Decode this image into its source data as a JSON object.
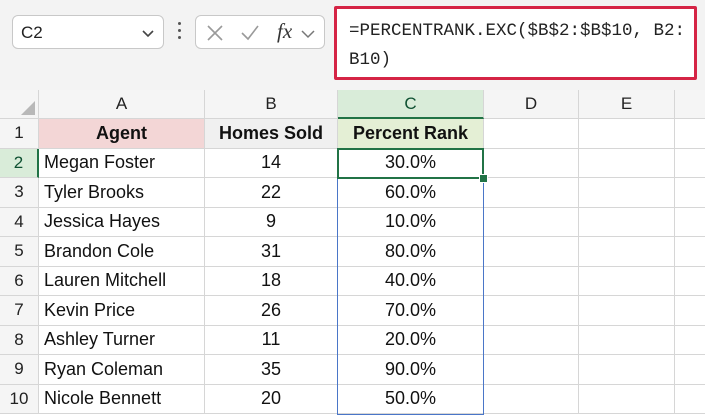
{
  "name_box": {
    "value": "C2"
  },
  "formula_bar": {
    "fx_label": "fx",
    "formula": "=PERCENTRANK.EXC($B$2:$B$10, B2:B10)"
  },
  "columns": [
    "A",
    "B",
    "C",
    "D",
    "E"
  ],
  "rows": [
    "1",
    "2",
    "3",
    "4",
    "5",
    "6",
    "7",
    "8",
    "9",
    "10"
  ],
  "headers": {
    "agent": "Agent",
    "homes_sold": "Homes Sold",
    "percent_rank": "Percent Rank"
  },
  "table": [
    {
      "agent": "Megan Foster",
      "homes": "14",
      "rank": "30.0%"
    },
    {
      "agent": "Tyler Brooks",
      "homes": "22",
      "rank": "60.0%"
    },
    {
      "agent": "Jessica Hayes",
      "homes": "9",
      "rank": "10.0%"
    },
    {
      "agent": "Brandon Cole",
      "homes": "31",
      "rank": "80.0%"
    },
    {
      "agent": "Lauren Mitchell",
      "homes": "18",
      "rank": "40.0%"
    },
    {
      "agent": "Kevin Price",
      "homes": "26",
      "rank": "70.0%"
    },
    {
      "agent": "Ashley Turner",
      "homes": "11",
      "rank": "20.0%"
    },
    {
      "agent": "Ryan Coleman",
      "homes": "35",
      "rank": "90.0%"
    },
    {
      "agent": "Nicole Bennett",
      "homes": "20",
      "rank": "50.0%"
    }
  ],
  "colors": {
    "formula_highlight": "#d52445",
    "selection": "#217346",
    "range_outline": "#4a76c8",
    "agent_header_fill": "#f3d6d6",
    "rank_header_fill": "#e4efd5"
  },
  "icons": [
    "chevron-down-icon",
    "more-options-icon",
    "cancel-icon",
    "enter-icon",
    "function-icon"
  ]
}
